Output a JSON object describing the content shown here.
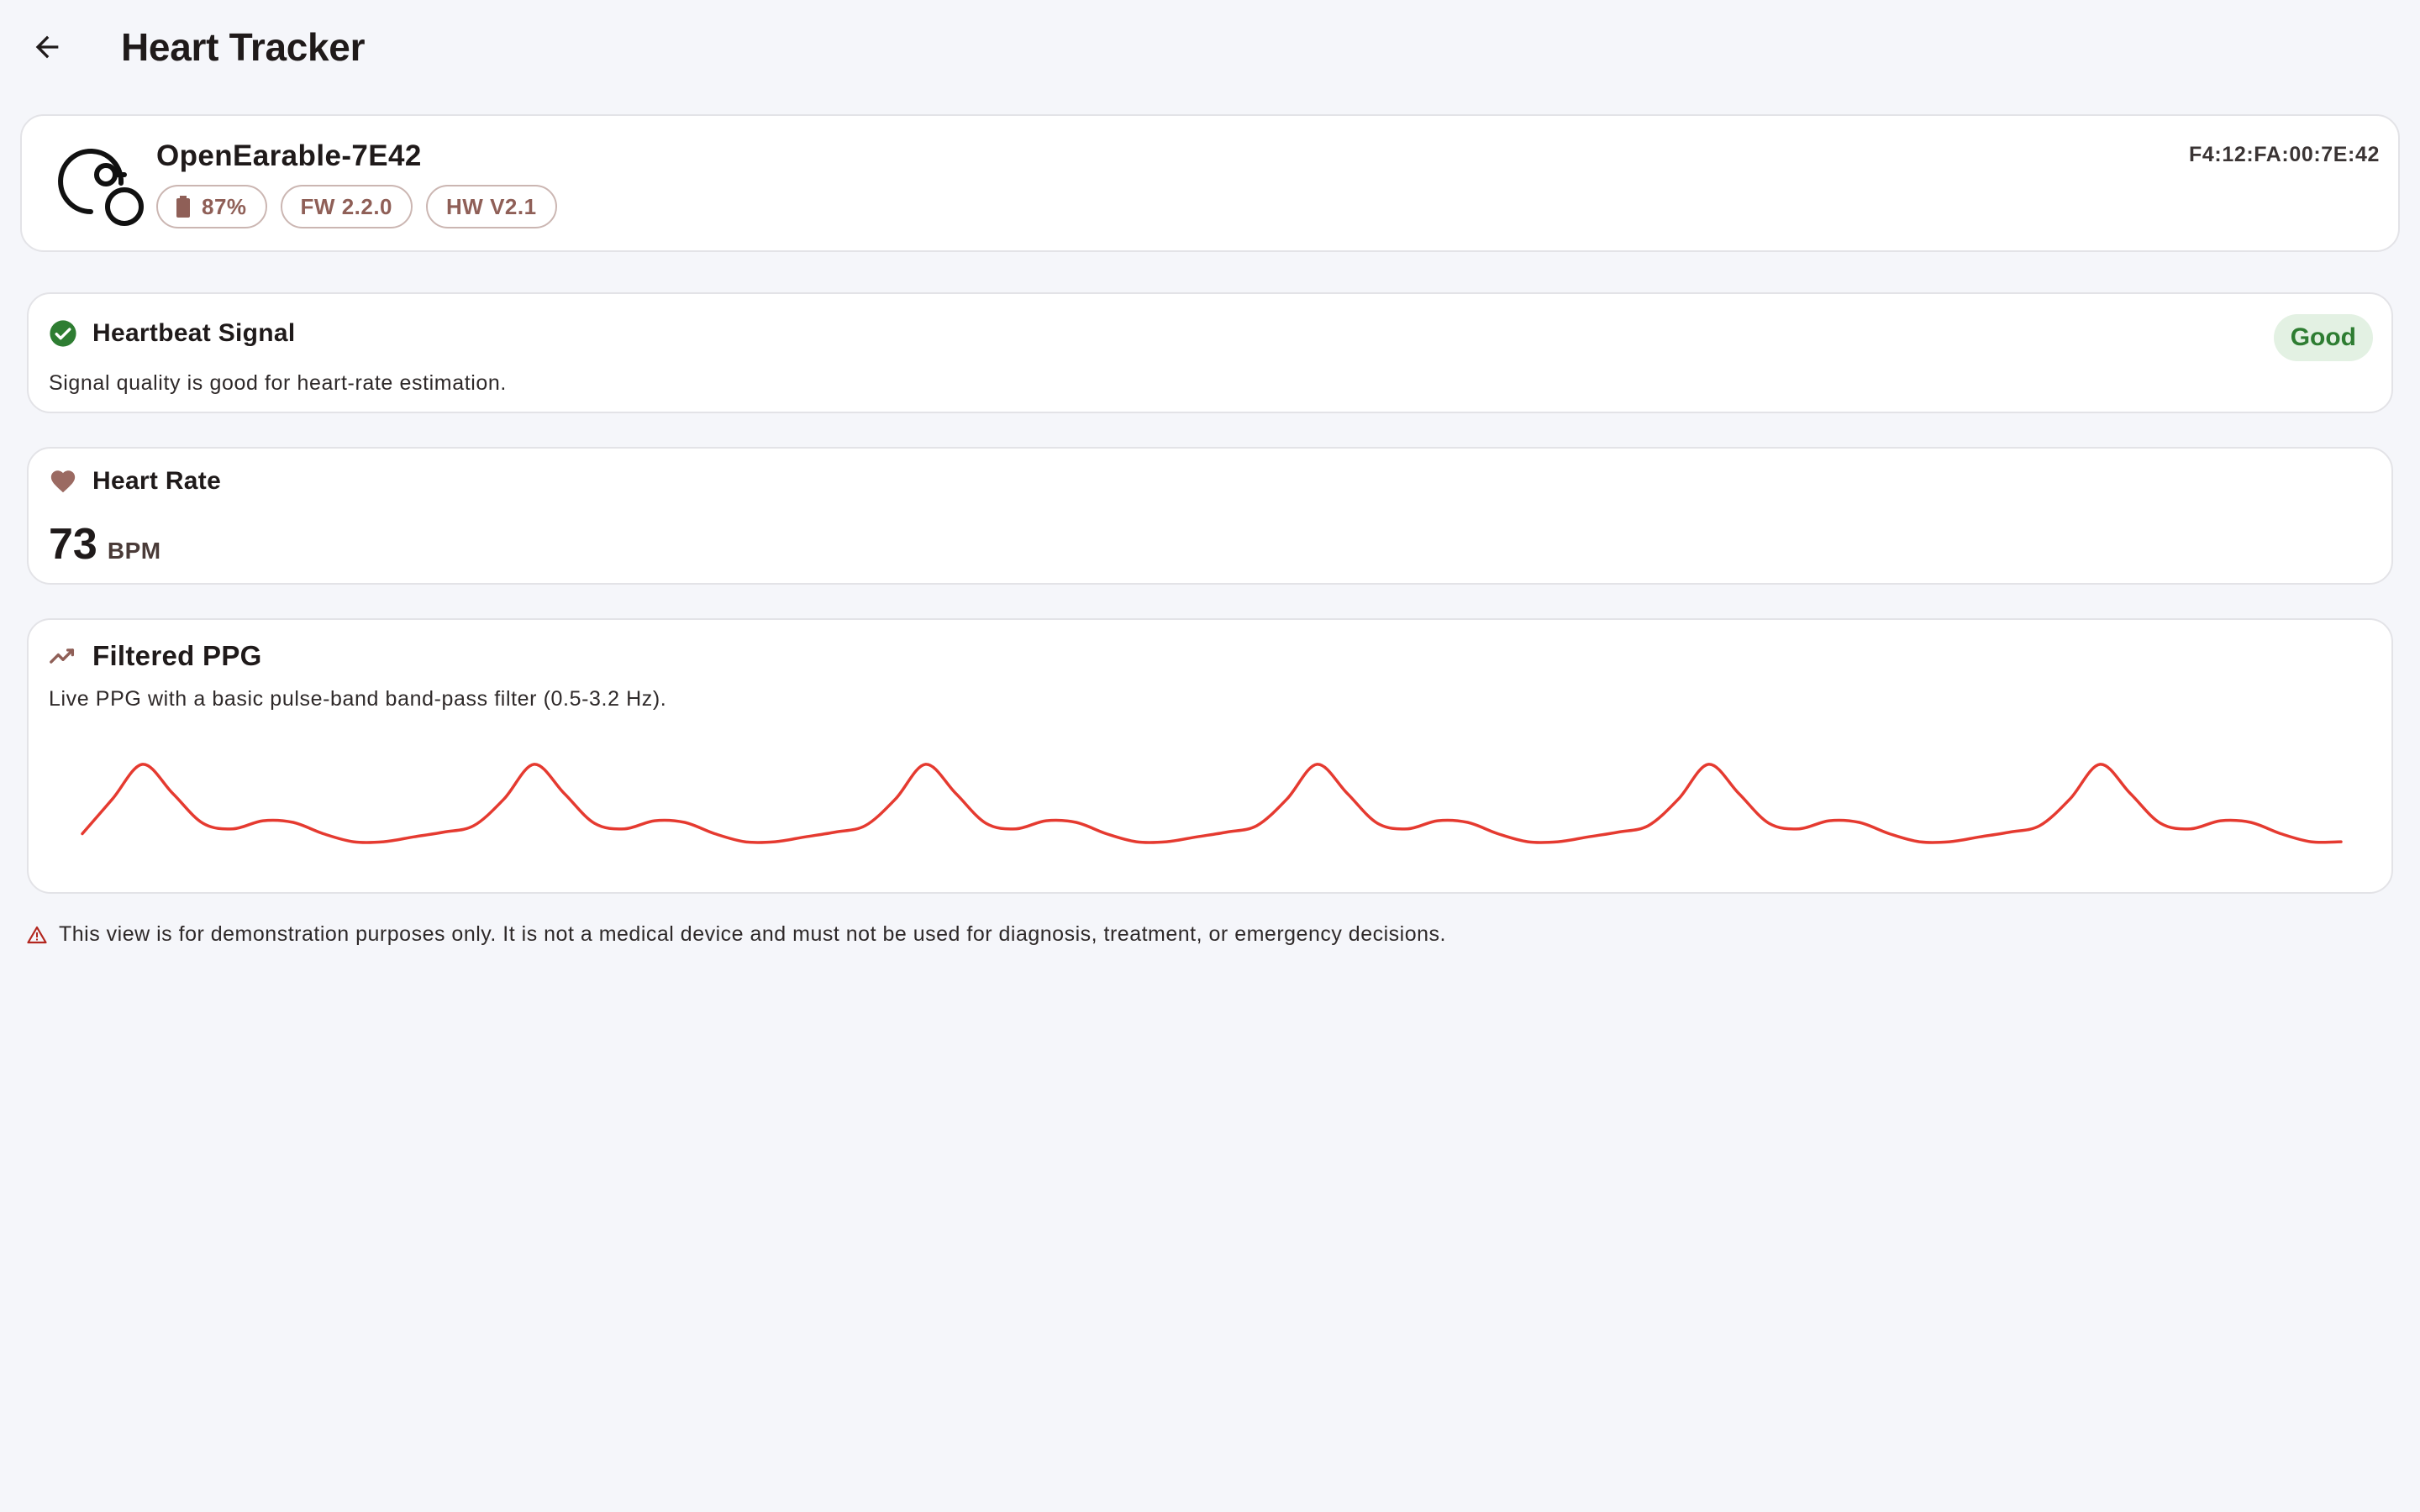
{
  "header": {
    "title": "Heart Tracker",
    "back_icon": "arrow-back-icon"
  },
  "device": {
    "name": "OpenEarable-7E42",
    "mac": "F4:12:FA:00:7E:42",
    "icon": "earable-device-icon",
    "chips": [
      {
        "label": "87%",
        "icon": "battery-icon"
      },
      {
        "label": "FW 2.2.0"
      },
      {
        "label": "HW V2.1"
      }
    ]
  },
  "signal": {
    "title": "Heartbeat Signal",
    "subtitle": "Signal quality is good for heart-rate estimation.",
    "badge": "Good",
    "icon": "check-circle-icon",
    "status_color": "#2e7d32"
  },
  "heart_rate": {
    "title": "Heart Rate",
    "value": "73",
    "unit": "BPM",
    "icon": "heart-icon"
  },
  "ppg": {
    "title": "Filtered PPG",
    "subtitle": "Live PPG with a basic pulse-band band-pass filter (0.5-3.2 Hz).",
    "icon": "trending-line-icon",
    "line_color": "#e53a30",
    "chart_data": {
      "type": "line",
      "title": "",
      "xlabel": "",
      "ylabel": "",
      "grid": false,
      "beats": 6,
      "series": [
        {
          "values": [
            0.12,
            0.55,
            0.98,
            0.62,
            0.25,
            0.18,
            0.28,
            0.26,
            0.12,
            0.02,
            0.02,
            0.08,
            0.14,
            0.22,
            0.55,
            0.98,
            0.62,
            0.25,
            0.18,
            0.28,
            0.26,
            0.12,
            0.02,
            0.02,
            0.08,
            0.14,
            0.22,
            0.55,
            0.98,
            0.62,
            0.25,
            0.18,
            0.28,
            0.26,
            0.12,
            0.02,
            0.02,
            0.08,
            0.14,
            0.22,
            0.55,
            0.98,
            0.62,
            0.25,
            0.18,
            0.28,
            0.26,
            0.12,
            0.02,
            0.02,
            0.08,
            0.14,
            0.22,
            0.55,
            0.98,
            0.62,
            0.25,
            0.18,
            0.28,
            0.26,
            0.12,
            0.02,
            0.02,
            0.08,
            0.14,
            0.22,
            0.55,
            0.98,
            0.62,
            0.25,
            0.18,
            0.28,
            0.26,
            0.12,
            0.02,
            0.02
          ]
        }
      ]
    }
  },
  "disclaimer": {
    "icon": "warning-icon",
    "text": "This view is for demonstration purposes only. It is not a medical device and must not be used for diagnosis, treatment, or emergency decisions."
  }
}
